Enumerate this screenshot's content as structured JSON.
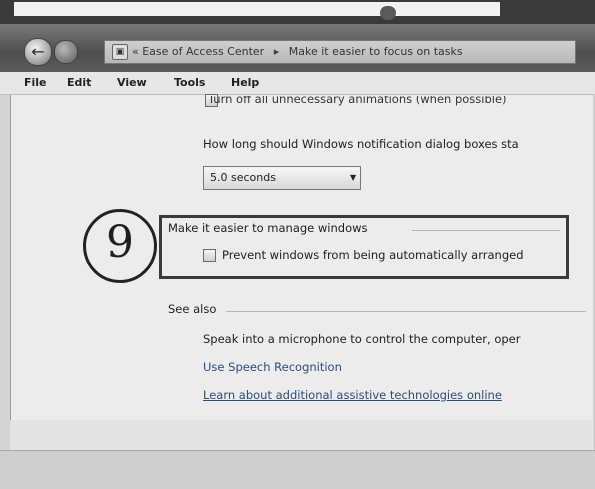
{
  "address_bar": {
    "back_arrow": "←",
    "icon": "control-panel-icon",
    "prefix": "«",
    "crumb_1": "Ease of Access Center",
    "separator": "▸",
    "crumb_2": "Make it easier to focus on tasks"
  },
  "menu": {
    "file": "File",
    "edit": "Edit",
    "view": "View",
    "tools": "Tools",
    "help": "Help"
  },
  "settings": {
    "animations_partial": "Turn off all unnecessary animations (when possible)",
    "notification_question": "How long should Windows notification dialog boxes sta",
    "notification_value": "5.0 seconds",
    "dropdown_arrow": "▼",
    "manage_windows_heading": "Make it easier to manage windows",
    "prevent_arrange_label": "Prevent windows from being automatically arranged"
  },
  "callout": {
    "number": "9"
  },
  "see_also": {
    "heading": "See also",
    "speech_text": "Speak into a microphone to control the computer, oper",
    "speech_link": "Use Speech Recognition",
    "assistive_link": "Learn about additional assistive technologies online"
  },
  "colors": {
    "link": "#2a4d7a",
    "highlight_border": "#3a3a3a"
  }
}
